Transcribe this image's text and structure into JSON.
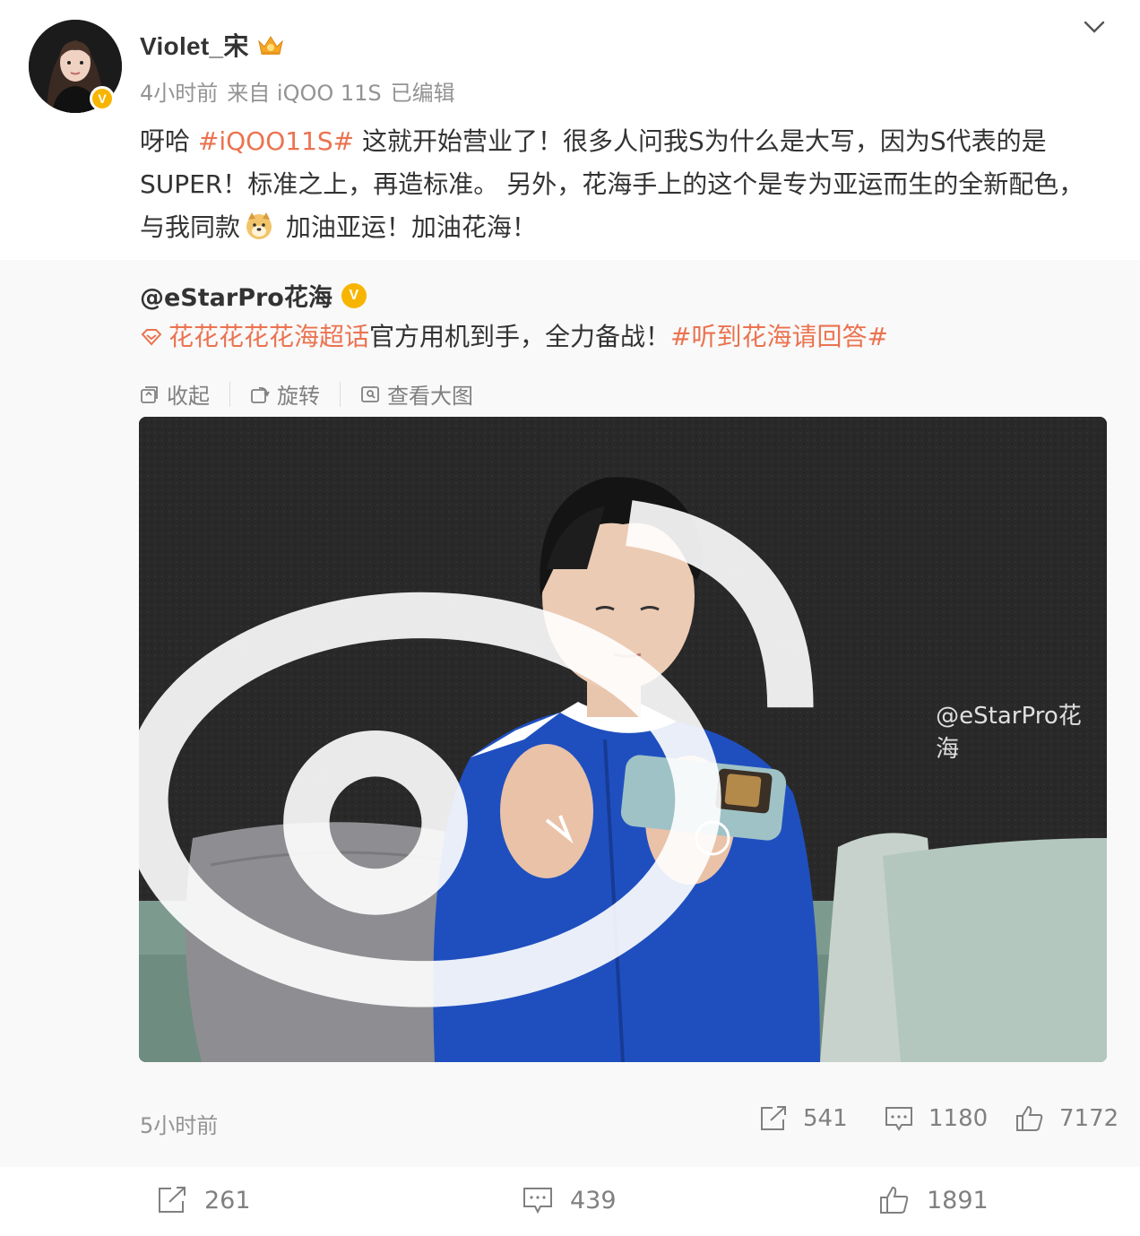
{
  "post": {
    "username": "Violet_宋",
    "time": "4小时前",
    "source": "来自 iQOO 11S",
    "edited": "已编辑",
    "text": {
      "part1": "呀哈 ",
      "topic": "#iQOO11S#",
      "part2": " 这就开始营业了！很多人问我S为什么是大写，因为S代表的是SUPER！标准之上，再造标准。 另外，花海手上的这个是专为亚运而生的全新配色，与我同款",
      "part3": " 加油亚运！加油花海！"
    }
  },
  "repost": {
    "author": "@eStarPro花海",
    "supertopic": "花花花花花海超话",
    "text": "官方用机到手，全力备战！",
    "topic": "#听到花海请回答#",
    "toolbar": {
      "collapse": "收起",
      "rotate": "旋转",
      "view_large": "查看大图"
    },
    "watermark": "@eStarPro花海",
    "time": "5小时前",
    "stats": {
      "reposts": "541",
      "comments": "1180",
      "likes": "7172"
    }
  },
  "footer": {
    "reposts": "261",
    "comments": "439",
    "likes": "1891"
  },
  "colors": {
    "topic": "#eb7350",
    "badge": "#f7b500",
    "muted": "#939393"
  }
}
